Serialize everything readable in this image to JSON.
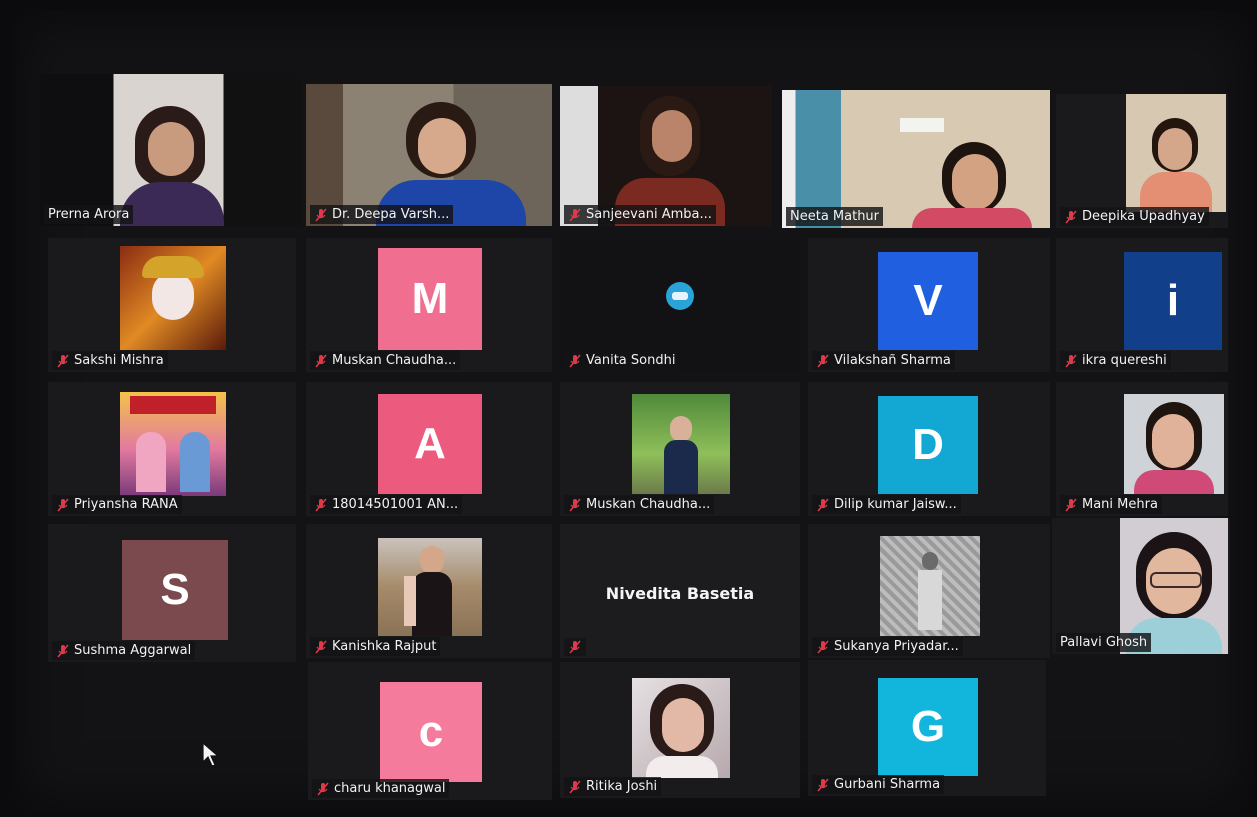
{
  "gallery": {
    "participants": [
      {
        "name": "Prerna Arora",
        "muted": false,
        "kind": "video",
        "active": true
      },
      {
        "name": "Dr. Deepa Varsh...",
        "muted": true,
        "kind": "video"
      },
      {
        "name": "Sanjeevani Amba...",
        "muted": true,
        "kind": "video"
      },
      {
        "name": "Neeta Mathur",
        "muted": false,
        "kind": "video"
      },
      {
        "name": "Deepika Upadhyay",
        "muted": true,
        "kind": "video"
      },
      {
        "name": "Sakshi Mishra",
        "muted": true,
        "kind": "picture"
      },
      {
        "name": "Muskan Chaudha...",
        "muted": true,
        "kind": "avatar",
        "initial": "M",
        "color": "#f06f91"
      },
      {
        "name": "Vanita Sondhi",
        "muted": true,
        "kind": "picture"
      },
      {
        "name": "Vilakshañ Sharma",
        "muted": true,
        "kind": "avatar",
        "initial": "V",
        "color": "#1f5fe0"
      },
      {
        "name": "ikra quereshi",
        "muted": true,
        "kind": "avatar",
        "initial": "i",
        "color": "#123f8a"
      },
      {
        "name": "Priyansha RANA",
        "muted": true,
        "kind": "picture"
      },
      {
        "name": "18014501001 AN...",
        "muted": true,
        "kind": "avatar",
        "initial": "A",
        "color": "#ec5a7e"
      },
      {
        "name": "Muskan Chaudha...",
        "muted": true,
        "kind": "picture"
      },
      {
        "name": "Dilip kumar Jaisw...",
        "muted": true,
        "kind": "avatar",
        "initial": "D",
        "color": "#13a8d4"
      },
      {
        "name": "Mani Mehra",
        "muted": true,
        "kind": "picture"
      },
      {
        "name": "Sushma Aggarwal",
        "muted": true,
        "kind": "avatar",
        "initial": "S",
        "color": "#7a4a4e"
      },
      {
        "name": "Kanishka Rajput",
        "muted": true,
        "kind": "picture"
      },
      {
        "name": "Nivedita Basetia",
        "muted": true,
        "kind": "name-only"
      },
      {
        "name": "Sukanya Priyadar...",
        "muted": true,
        "kind": "picture"
      },
      {
        "name": "Pallavi Ghosh",
        "muted": false,
        "kind": "video"
      },
      {
        "name": "charu khanagwal",
        "muted": true,
        "kind": "avatar",
        "initial": "c",
        "color": "#f47b9c"
      },
      {
        "name": "Ritika Joshi",
        "muted": true,
        "kind": "picture"
      },
      {
        "name": "Gurbani Sharma",
        "muted": true,
        "kind": "avatar",
        "initial": "G",
        "color": "#12b6dc"
      }
    ]
  },
  "colors": {
    "active_speaker": "#c8e04a",
    "mute_icon": "#e0394a",
    "tile_bg": "#1a1a1d"
  }
}
